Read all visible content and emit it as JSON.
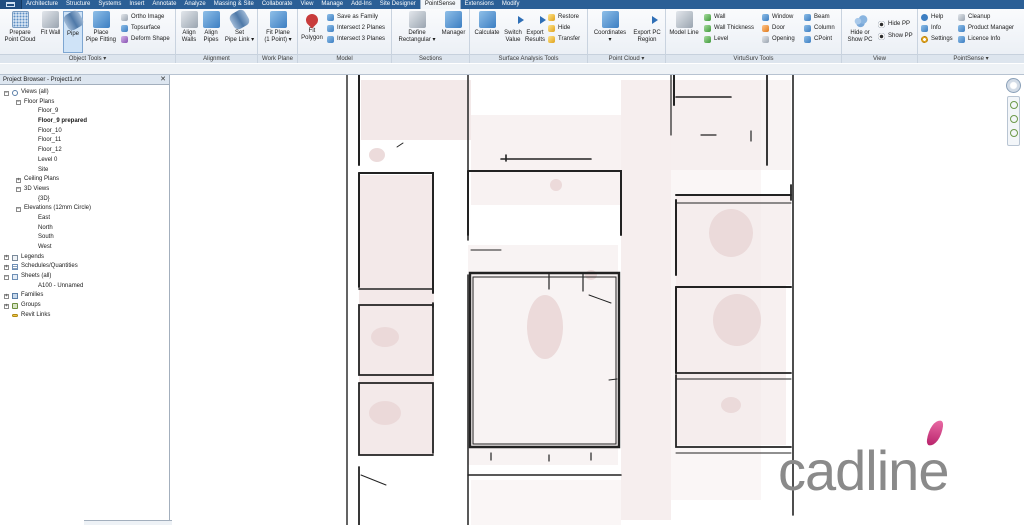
{
  "tabs": [
    {
      "label": "Architecture"
    },
    {
      "label": "Structure"
    },
    {
      "label": "Systems"
    },
    {
      "label": "Insert"
    },
    {
      "label": "Annotate"
    },
    {
      "label": "Analyze"
    },
    {
      "label": "Massing & Site"
    },
    {
      "label": "Collaborate"
    },
    {
      "label": "View"
    },
    {
      "label": "Manage"
    },
    {
      "label": "Add-Ins"
    },
    {
      "label": "Site Designer"
    },
    {
      "label": "PointSense",
      "active": true
    },
    {
      "label": "Extensions"
    },
    {
      "label": "Modify"
    }
  ],
  "ribbon": {
    "object_tools": {
      "title": "Object Tools ▾",
      "prepare": "Prepare\nPoint Cloud",
      "fit_wall": "Fit Wall",
      "pipe": "Pipe",
      "place_pipe_fitting": "Place\nPipe Fitting",
      "ortho_image": "Ortho Image",
      "topsurface": "Topsurface",
      "deform_shape": "Deform Shape"
    },
    "alignment": {
      "title": "Alignment",
      "align_walls": "Align\nWalls",
      "align_pipes": "Align\nPipes",
      "set_pipe_link": "Set\nPipe Link ▾"
    },
    "work_plane": {
      "title": "Work Plane",
      "fit_plane": "Fit Plane\n(1 Point) ▾"
    },
    "model": {
      "title": "Model",
      "fit_polygon": "Fit\nPolygon",
      "save_as_family": "Save as Family",
      "intersect2": "Intersect 2 Planes",
      "intersect3": "Intersect 3 Planes"
    },
    "sections": {
      "title": "Sections",
      "define_rect": "Define\nRectangular ▾",
      "manager": "Manager"
    },
    "surface_analysis": {
      "title": "Surface Analysis Tools",
      "calculate": "Calculate",
      "switch_value": "Switch\nValue",
      "export_results": "Export\nResults",
      "restore": "Restore",
      "hide": "Hide",
      "transfer": "Transfer"
    },
    "point_cloud": {
      "title": "Point Cloud ▾",
      "coordinates": "Coordinates\n▾",
      "export_pc_region": "Export PC\nRegion"
    },
    "virtusurv": {
      "title": "VirtuSurv Tools",
      "model_line": "Model Line",
      "wall": "Wall",
      "wall_thickness": "Wall Thickness",
      "level": "Level",
      "window": "Window",
      "door": "Door",
      "opening": "Opening",
      "beam": "Beam",
      "column": "Column",
      "cpoint": "CPoint"
    },
    "view": {
      "title": "View",
      "hide_show_pc": "Hide or\nShow PC",
      "hide_pp": "Hide PP",
      "show_pp": "Show PP"
    },
    "pointsense": {
      "title": "PointSense ▾",
      "help": "Help",
      "info": "Info",
      "settings": "Settings",
      "cleanup": "Cleanup",
      "product_manager": "Product Manager",
      "licence_info": "Licence Info"
    }
  },
  "browser": {
    "title": "Project Browser - Project1.rvt",
    "close": "✕",
    "tree": [
      {
        "label": "Views (all)",
        "level": 0,
        "toggle": "−",
        "glyph": "views"
      },
      {
        "label": "Floor Plans",
        "level": 1,
        "toggle": "−"
      },
      {
        "label": "Floor_9",
        "level": 2
      },
      {
        "label": "Floor_9 prepared",
        "level": 2,
        "bold": true
      },
      {
        "label": "Floor_10",
        "level": 2
      },
      {
        "label": "Floor_11",
        "level": 2
      },
      {
        "label": "Floor_12",
        "level": 2
      },
      {
        "label": "Level 0",
        "level": 2
      },
      {
        "label": "Site",
        "level": 2
      },
      {
        "label": "Ceiling Plans",
        "level": 1,
        "toggle": "+"
      },
      {
        "label": "3D Views",
        "level": 1,
        "toggle": "−"
      },
      {
        "label": "{3D}",
        "level": 2
      },
      {
        "label": "Elevations (12mm Circle)",
        "level": 1,
        "toggle": "−"
      },
      {
        "label": "East",
        "level": 2
      },
      {
        "label": "North",
        "level": 2
      },
      {
        "label": "South",
        "level": 2
      },
      {
        "label": "West",
        "level": 2
      },
      {
        "label": "Legends",
        "level": 0,
        "toggle": "+",
        "glyph": "legend"
      },
      {
        "label": "Schedules/Quantities",
        "level": 0,
        "toggle": "+",
        "glyph": "sched"
      },
      {
        "label": "Sheets (all)",
        "level": 0,
        "toggle": "−",
        "glyph": "sheet"
      },
      {
        "label": "A100 - Unnamed",
        "level": 2
      },
      {
        "label": "Families",
        "level": 0,
        "toggle": "+",
        "glyph": "family"
      },
      {
        "label": "Groups",
        "level": 0,
        "toggle": "+",
        "glyph": "group"
      },
      {
        "label": "Revit Links",
        "level": 0,
        "glyph": "link"
      }
    ]
  },
  "watermark": {
    "text": "cadline"
  },
  "colors": {
    "tab_bar": "#2b5f96",
    "scan_tint": "#f1e6e6",
    "wall_ink": "#222222",
    "logo_grey": "#8a8a8a",
    "logo_pink": "#c2307a"
  }
}
